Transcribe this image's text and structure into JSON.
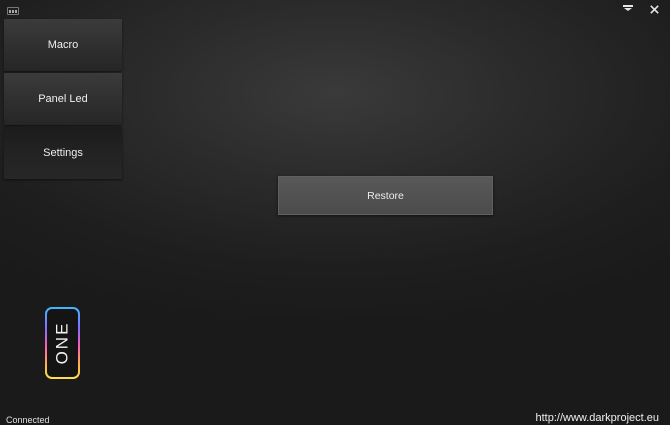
{
  "window": {
    "menu_icon": "menu-dropdown-icon",
    "close_icon": "close-icon",
    "close_glyph": "✕"
  },
  "sidebar": {
    "items": [
      {
        "label": "Macro"
      },
      {
        "label": "Panel Led"
      },
      {
        "label": "Settings"
      }
    ]
  },
  "main": {
    "restore_label": "Restore"
  },
  "device": {
    "badge_text": "ONE",
    "badge_colors": [
      "#3fb8ff",
      "#8a6cff",
      "#ff5fb0",
      "#ffb04a",
      "#ffe04a"
    ]
  },
  "footer": {
    "status": "Connected",
    "website": "http://www.darkproject.eu"
  },
  "colors": {
    "background": "#1e1e1e",
    "button": "#4f4f4f",
    "text": "#ececec"
  }
}
